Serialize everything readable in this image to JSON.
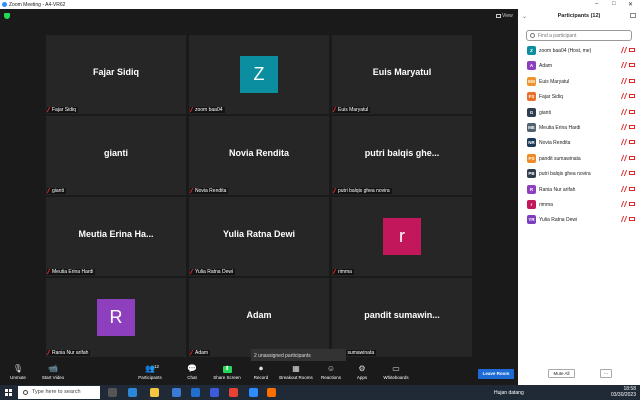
{
  "window": {
    "title": "Zoom Meeting - A4-VR62"
  },
  "view_label": "View",
  "tiles": [
    {
      "name": "Fajar Sidiq",
      "label": "Fajar Sidiq",
      "avatar": null,
      "color": null
    },
    {
      "name": null,
      "label": "zoom baa04",
      "avatar": "Z",
      "color": "#0b8fa0"
    },
    {
      "name": "Euis Maryatul",
      "label": "Euis Maryatul",
      "avatar": null,
      "color": null
    },
    {
      "name": "gianti",
      "label": "gianti",
      "avatar": null,
      "color": null
    },
    {
      "name": "Novia Rendita",
      "label": "Novia Rendita",
      "avatar": null,
      "color": null
    },
    {
      "name": "putri balqis ghe...",
      "label": "putri balqis ghea novira",
      "avatar": null,
      "color": null
    },
    {
      "name": "Meutia Erina Ha...",
      "label": "Meutia Erina Hardi",
      "avatar": null,
      "color": null
    },
    {
      "name": "Yulia Ratna Dewi",
      "label": "Yulia Ratna Dewi",
      "avatar": null,
      "color": null
    },
    {
      "name": null,
      "label": "rimma",
      "avatar": "r",
      "color": "#c2185b"
    },
    {
      "name": null,
      "label": "Rania Nur arifah",
      "avatar": "R",
      "color": "#8e3fbd"
    },
    {
      "name": "Adam",
      "label": "Adam",
      "avatar": null,
      "color": null
    },
    {
      "name": "pandit sumawin...",
      "label": "ndit sumawinata",
      "avatar": null,
      "color": null
    }
  ],
  "toast": "2 unassigned participants",
  "toolbar": [
    {
      "id": "unmute",
      "label": "Unmute",
      "icon": "mic-muted-icon"
    },
    {
      "id": "start-video",
      "label": "Start Video",
      "icon": "video-off-icon"
    },
    {
      "id": "participants",
      "label": "Participants",
      "icon": "participants-icon",
      "badge": "12"
    },
    {
      "id": "chat",
      "label": "Chat",
      "icon": "chat-icon"
    },
    {
      "id": "share-screen",
      "label": "Share Screen",
      "icon": "share-screen-icon"
    },
    {
      "id": "record",
      "label": "Record",
      "icon": "record-icon"
    },
    {
      "id": "breakout-rooms",
      "label": "Breakout Rooms",
      "icon": "breakout-rooms-icon"
    },
    {
      "id": "reactions",
      "label": "Reactions",
      "icon": "reactions-icon"
    },
    {
      "id": "apps",
      "label": "Apps",
      "icon": "apps-icon"
    },
    {
      "id": "whiteboards",
      "label": "Whiteboards",
      "icon": "whiteboards-icon"
    }
  ],
  "leave_label": "Leave Room",
  "panel": {
    "title": "Participants (12)",
    "search_placeholder": "Find a participant",
    "participants": [
      {
        "initials": "Z",
        "name": "zoom baa04 (Host, me)",
        "color": "#0b8fa0"
      },
      {
        "initials": "A",
        "name": "Adam",
        "color": "#8e3fbd"
      },
      {
        "initials": "EM",
        "name": "Euis Maryatul",
        "color": "#f0932b"
      },
      {
        "initials": "FS",
        "name": "Fajar Sidiq",
        "color": "#e8712a"
      },
      {
        "initials": "G",
        "name": "gianti",
        "color": "#2d3e50"
      },
      {
        "initials": "ME",
        "name": "Meutia Erina Hardi",
        "color": "#4f6272"
      },
      {
        "initials": "NR",
        "name": "Novia Rendita",
        "color": "#1b3a5c"
      },
      {
        "initials": "PS",
        "name": "pandit sumawinata",
        "color": "#f08a24"
      },
      {
        "initials": "PB",
        "name": "putri balqis ghea novira",
        "color": "#2f3d4c"
      },
      {
        "initials": "R",
        "name": "Rania Nur arifah",
        "color": "#8e3fbd"
      },
      {
        "initials": "r",
        "name": "rimma",
        "color": "#c2185b"
      },
      {
        "initials": "YR",
        "name": "Yulia Ratna Dewi",
        "color": "#7b3fbd"
      }
    ],
    "mute_all": "Mute All",
    "more": "..."
  },
  "taskbar": {
    "search_placeholder": "Type here to search",
    "weather": "Hujan datang",
    "time": "18:58",
    "date": "03/30/2023"
  }
}
